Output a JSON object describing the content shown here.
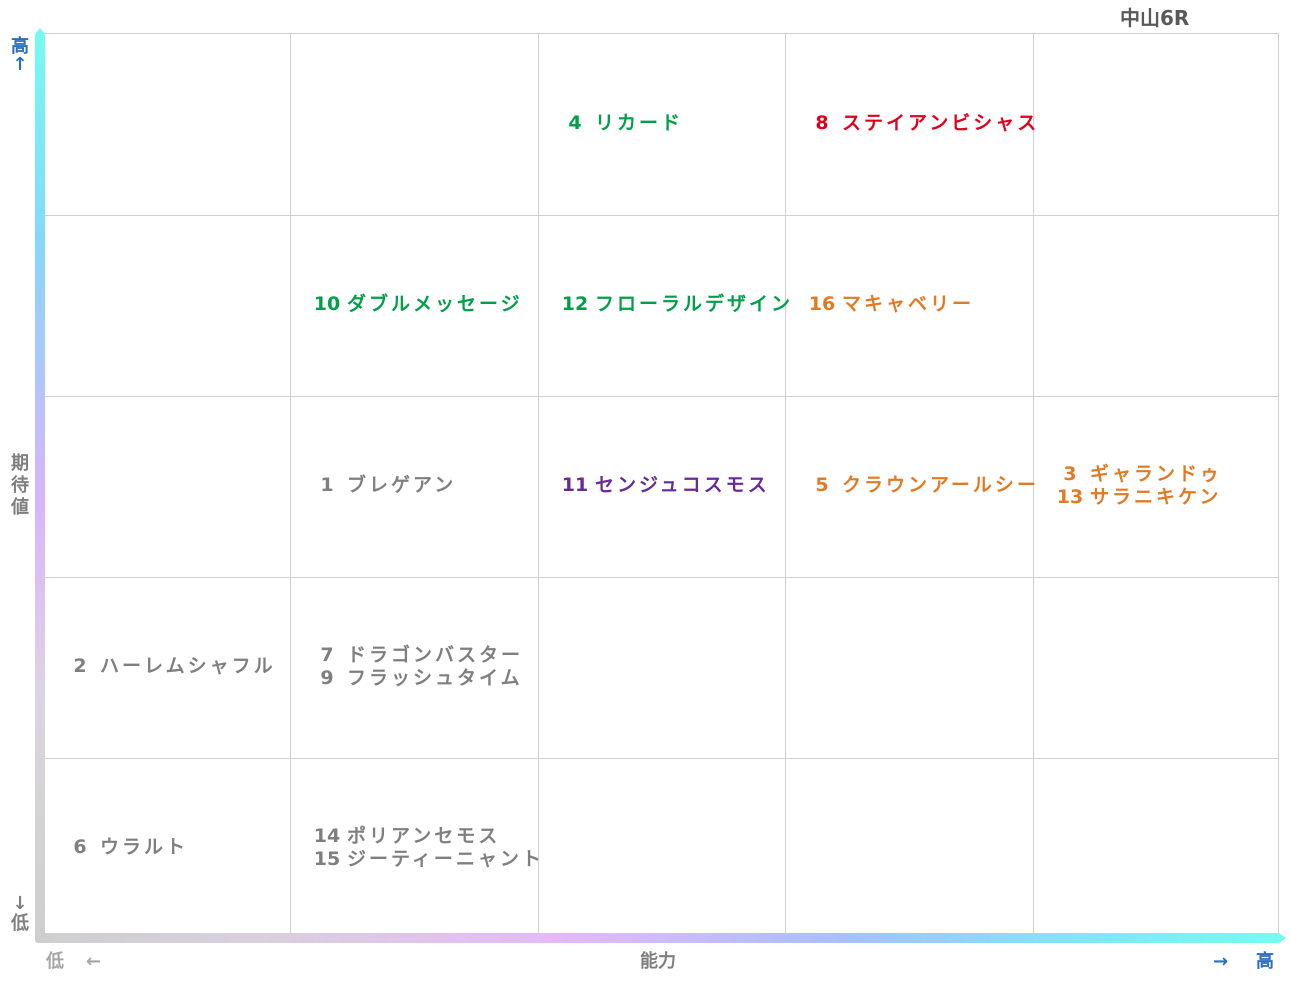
{
  "race_title": "中山6R",
  "chart_data": {
    "type": "table",
    "x_axis": {
      "label": "能力",
      "low": "低",
      "high": "高",
      "low_arrow": "←",
      "high_arrow": "→",
      "levels": 5
    },
    "y_axis": {
      "label": "期待値",
      "low": "低",
      "high": "高",
      "low_arrow": "↓",
      "high_arrow": "↑",
      "levels": 5
    },
    "colors": {
      "green": "#00a04a",
      "red": "#e0001b",
      "orange": "#e27a24",
      "purple": "#6a2a96",
      "gray": "#7f7f7f"
    },
    "cells": [
      {
        "col": 3,
        "row": 1,
        "horses": [
          {
            "num": "4",
            "name": "リカード",
            "color": "#00a04a"
          }
        ]
      },
      {
        "col": 4,
        "row": 1,
        "horses": [
          {
            "num": "8",
            "name": "ステイアンビシャス",
            "color": "#e0001b"
          }
        ]
      },
      {
        "col": 2,
        "row": 2,
        "horses": [
          {
            "num": "10",
            "name": "ダブルメッセージ",
            "color": "#00a04a"
          }
        ]
      },
      {
        "col": 3,
        "row": 2,
        "horses": [
          {
            "num": "12",
            "name": "フローラルデザイン",
            "color": "#00a04a"
          }
        ]
      },
      {
        "col": 4,
        "row": 2,
        "horses": [
          {
            "num": "16",
            "name": "マキャベリー",
            "color": "#e27a24"
          }
        ]
      },
      {
        "col": 2,
        "row": 3,
        "horses": [
          {
            "num": "1",
            "name": "ブレゲアン",
            "color": "#7f7f7f"
          }
        ]
      },
      {
        "col": 3,
        "row": 3,
        "horses": [
          {
            "num": "11",
            "name": "センジュコスモス",
            "color": "#6a2a96"
          }
        ]
      },
      {
        "col": 4,
        "row": 3,
        "horses": [
          {
            "num": "5",
            "name": "クラウンアールシー",
            "color": "#e27a24"
          }
        ]
      },
      {
        "col": 5,
        "row": 3,
        "horses": [
          {
            "num": "3",
            "name": "ギャランドゥ",
            "color": "#e27a24"
          },
          {
            "num": "13",
            "name": "サラニキケン",
            "color": "#e27a24"
          }
        ]
      },
      {
        "col": 1,
        "row": 4,
        "horses": [
          {
            "num": "2",
            "name": "ハーレムシャフル",
            "color": "#7f7f7f"
          }
        ]
      },
      {
        "col": 2,
        "row": 4,
        "horses": [
          {
            "num": "7",
            "name": "ドラゴンバスター",
            "color": "#7f7f7f"
          },
          {
            "num": "9",
            "name": "フラッシュタイム",
            "color": "#7f7f7f"
          }
        ]
      },
      {
        "col": 1,
        "row": 5,
        "horses": [
          {
            "num": "6",
            "name": "ウラルト",
            "color": "#7f7f7f"
          }
        ]
      },
      {
        "col": 2,
        "row": 5,
        "horses": [
          {
            "num": "14",
            "name": "ポリアンセモス",
            "color": "#7f7f7f"
          },
          {
            "num": "15",
            "name": "ジーティーニャント",
            "color": "#7f7f7f"
          }
        ]
      }
    ]
  }
}
